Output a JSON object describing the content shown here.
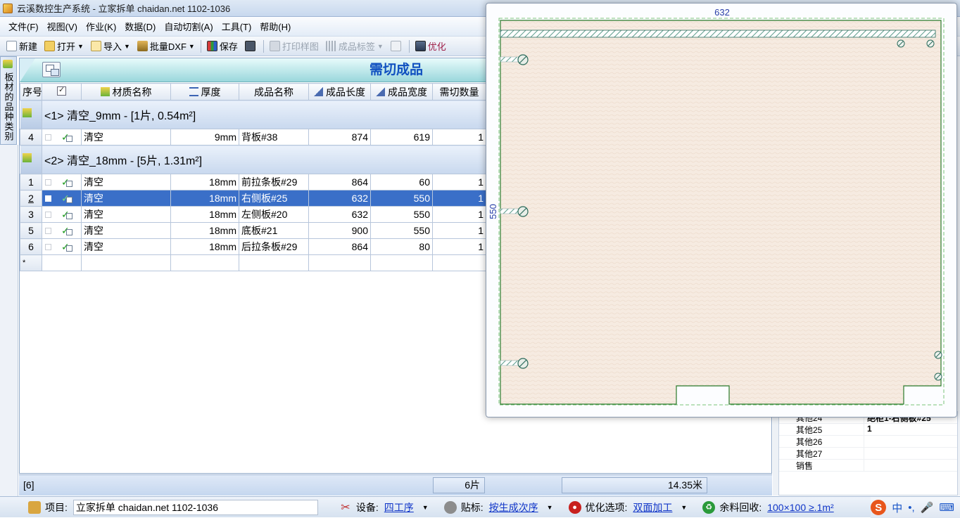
{
  "window": {
    "title": "云溪数控生产系统 - 立家拆单 chaidan.net 1102-1036"
  },
  "menu": [
    "文件(F)",
    "视图(V)",
    "作业(K)",
    "数据(D)",
    "自动切割(A)",
    "工具(T)",
    "帮助(H)"
  ],
  "toolbar": {
    "new": "新建",
    "open": "打开",
    "import": "导入",
    "batch_dxf": "批量DXF",
    "save": "保存",
    "print_sample": "打印样图",
    "product_label": "成品标签",
    "optimize": "优化"
  },
  "left_tab": {
    "label": "板材的品种类别"
  },
  "grid": {
    "title": "需切成品",
    "headers": {
      "index": "序号",
      "material": "材质名称",
      "thickness": "厚度",
      "product": "成品名称",
      "length": "成品长度",
      "width": "成品宽度",
      "qty": "需切数量"
    },
    "groups": [
      {
        "label": "<1> 清空_9mm - [1片, 0.54m²]",
        "rows": [
          {
            "idx": "4",
            "material": "清空",
            "thickness": "9mm",
            "product": "背板#38",
            "length": "874",
            "width": "619",
            "qty": "1"
          }
        ]
      },
      {
        "label": "<2> 清空_18mm - [5片, 1.31m²]",
        "rows": [
          {
            "idx": "1",
            "material": "清空",
            "thickness": "18mm",
            "product": "前拉条板#29",
            "length": "864",
            "width": "60",
            "qty": "1"
          },
          {
            "idx": "2",
            "material": "清空",
            "thickness": "18mm",
            "product": "右侧板#25",
            "length": "632",
            "width": "550",
            "qty": "1"
          },
          {
            "idx": "3",
            "material": "清空",
            "thickness": "18mm",
            "product": "左侧板#20",
            "length": "632",
            "width": "550",
            "qty": "1"
          },
          {
            "idx": "5",
            "material": "清空",
            "thickness": "18mm",
            "product": "底板#21",
            "length": "900",
            "width": "550",
            "qty": "1"
          },
          {
            "idx": "6",
            "material": "清空",
            "thickness": "18mm",
            "product": "后拉条板#29",
            "length": "864",
            "width": "80",
            "qty": "1"
          }
        ]
      }
    ],
    "new_row_marker": "*",
    "selected_row": 2
  },
  "footer": {
    "count": "[6]",
    "pieces": "6片",
    "length": "14.35米"
  },
  "properties": [
    {
      "k": "其他24",
      "v": "绝柜1-右侧板#25"
    },
    {
      "k": "其他25",
      "v": "1"
    },
    {
      "k": "其他26",
      "v": ""
    },
    {
      "k": "其他27",
      "v": ""
    },
    {
      "k": "销售",
      "v": ""
    }
  ],
  "preview": {
    "width_label": "632",
    "height_label": "550"
  },
  "status": {
    "project_label": "项目:",
    "project_value": "立家拆单 chaidan.net 1102-1036",
    "device_label": "设备:",
    "device_value": "四工序",
    "edge_label": "贴标:",
    "edge_value": "按生成次序",
    "opt_label": "优化选项:",
    "opt_value": "双面加工",
    "remnant_label": "余料回收:",
    "remnant_value": "100×100 ≥.1m²"
  },
  "ime": {
    "logo": "S",
    "mode": "中",
    "punct": "•,"
  },
  "colors": {
    "title_blue": "#1050c0",
    "selection": "#3a6fc8",
    "panel_fill": "#f6ebe1",
    "panel_green": "#2a7a2a",
    "link": "#1035c8"
  }
}
